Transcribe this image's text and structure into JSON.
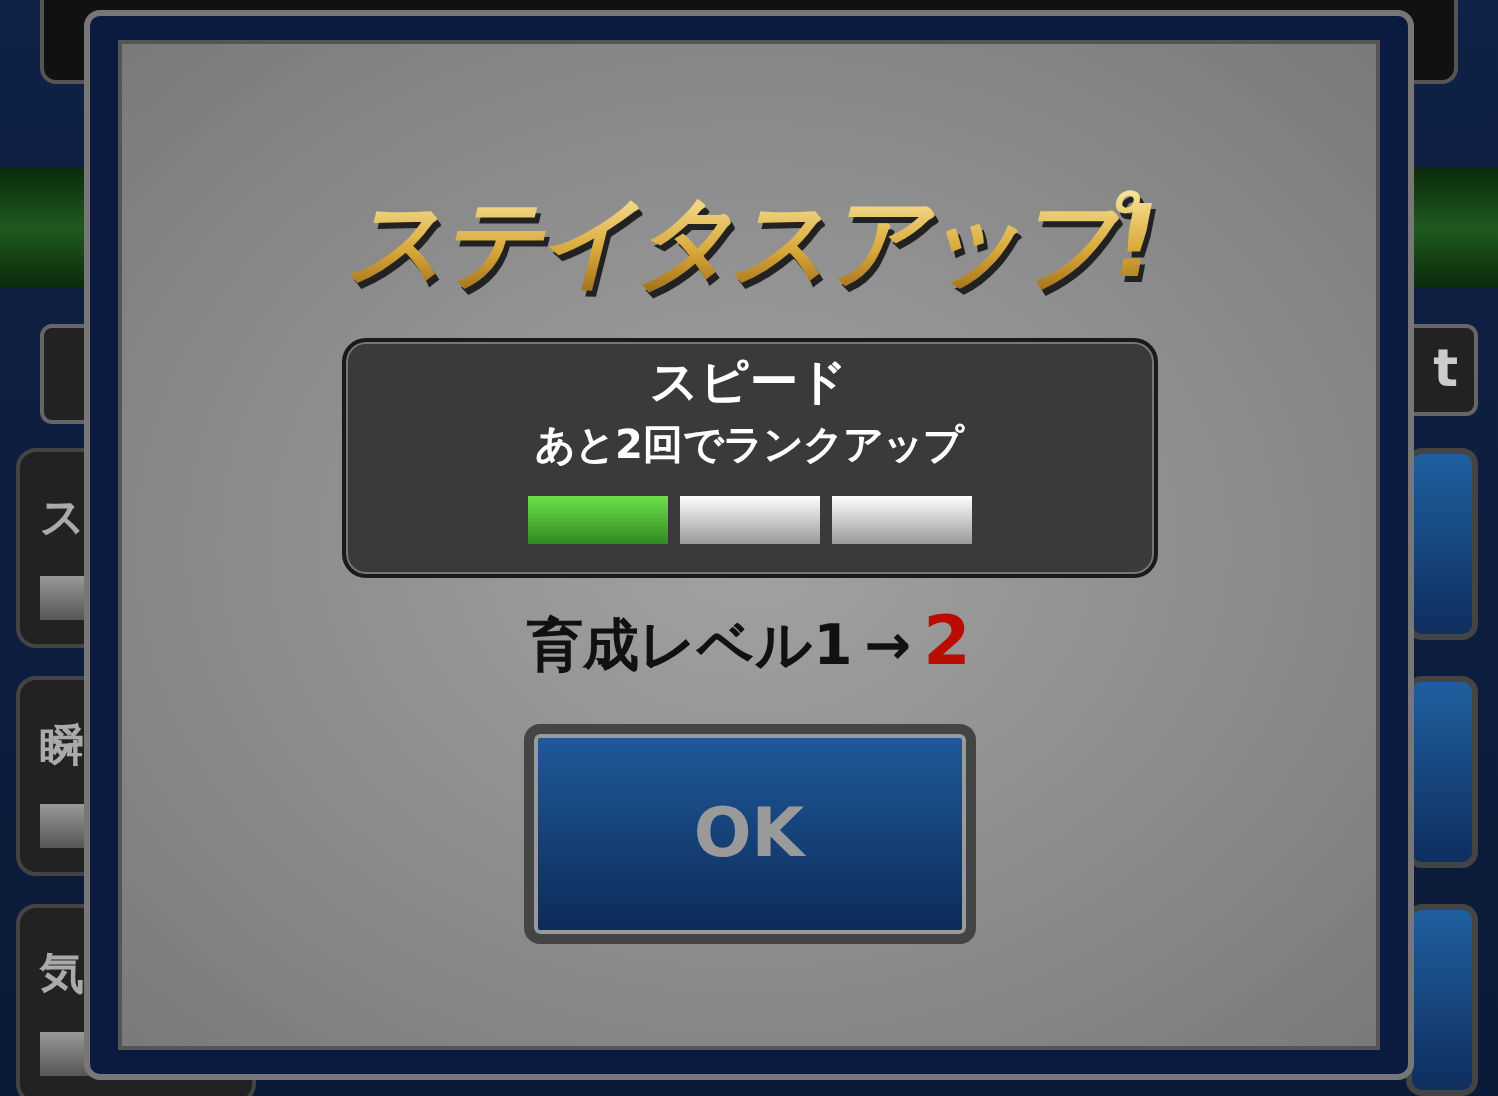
{
  "background": {
    "cards": [
      {
        "label": "ス"
      },
      {
        "label": "瞬"
      },
      {
        "label": "気"
      }
    ],
    "tab_right": "t"
  },
  "dialog": {
    "title": "ステイタスアップ!",
    "stat": "スピード",
    "message": "あと2回でランクアップ",
    "segments": [
      {
        "filled": true
      },
      {
        "filled": false
      },
      {
        "filled": false
      }
    ],
    "level_from": "育成レベル1",
    "arrow": "→",
    "level_to": "2",
    "ok_button": "OK"
  }
}
